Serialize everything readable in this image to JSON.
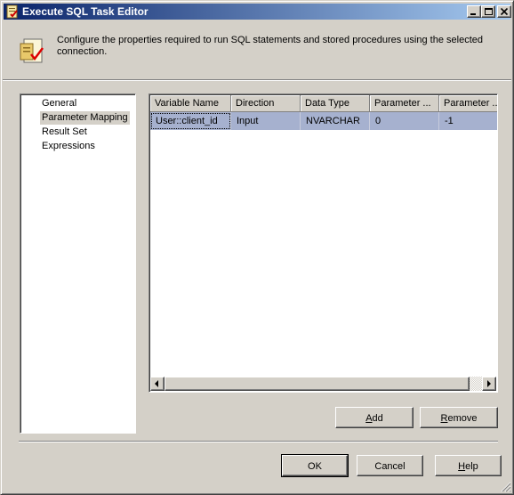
{
  "window": {
    "title": "Execute SQL Task Editor",
    "titlebar_gradient": [
      "#0a246a",
      "#a6caf0"
    ]
  },
  "header": {
    "description": "Configure the properties required to run SQL statements and stored procedures using the selected connection."
  },
  "nav": {
    "items": [
      {
        "label": "General",
        "selected": false
      },
      {
        "label": "Parameter Mapping",
        "selected": true
      },
      {
        "label": "Result Set",
        "selected": false
      },
      {
        "label": "Expressions",
        "selected": false
      }
    ]
  },
  "grid": {
    "columns": [
      "Variable Name",
      "Direction",
      "Data Type",
      "Parameter ...",
      "Parameter ..."
    ],
    "rows": [
      [
        "User::client_id",
        "Input",
        "NVARCHAR",
        "0",
        "-1"
      ]
    ],
    "selected_row_color": "#a6b1cf"
  },
  "buttons": {
    "add": {
      "prefix": "",
      "mnemonic": "A",
      "suffix": "dd"
    },
    "remove": {
      "prefix": "",
      "mnemonic": "R",
      "suffix": "emove"
    },
    "ok": "OK",
    "cancel": "Cancel",
    "help": {
      "prefix": "",
      "mnemonic": "H",
      "suffix": "elp"
    }
  }
}
